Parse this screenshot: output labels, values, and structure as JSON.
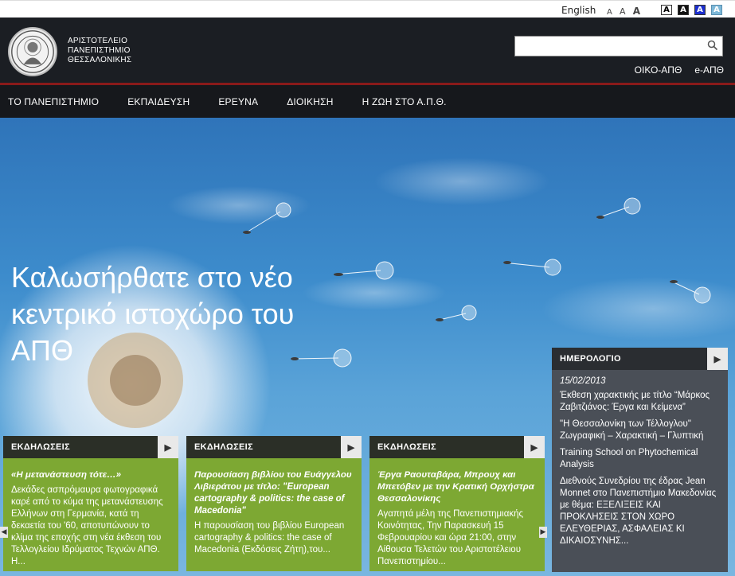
{
  "topbar": {
    "language": "English",
    "font_sizes": [
      "A",
      "A",
      "A"
    ],
    "contrast_options": [
      "A",
      "A",
      "A",
      "A"
    ]
  },
  "header": {
    "university_name": [
      "ΑΡΙΣΤΟΤΕΛΕΙΟ",
      "ΠΑΝΕΠΙΣΤΗΜΙΟ",
      "ΘΕΣΣΑΛΟΝΙΚΗΣ"
    ],
    "search_placeholder": "",
    "links": [
      "ΟΙΚΟ-ΑΠΘ",
      "e-ΑΠΘ"
    ]
  },
  "nav": {
    "items": [
      "ΤΟ ΠΑΝΕΠΙΣΤΗΜΙΟ",
      "ΕΚΠΑΙΔΕΥΣΗ",
      "ΕΡΕΥΝΑ",
      "ΔΙΟΙΚΗΣΗ",
      "Η ΖΩΗ ΣΤΟ Α.Π.Θ."
    ]
  },
  "hero": {
    "welcome": "Καλωσήρθατε στο νέο κεντρικό ιστοχώρο του ΑΠΘ"
  },
  "cards": [
    {
      "heading": "ΕΚΔΗΛΩΣΕΙΣ",
      "title": "«Η μετανάστευση τότε…»",
      "body": "Δεκάδες ασπρόμαυρα φωτογραφικά καρέ από το κύμα της μετανάστευσης Ελλήνων στη Γερμανία, κατά τη δεκαετία του '60, αποτυπώνουν το κλίμα της εποχής στη νέα έκθεση του Τελλογλείου Ιδρύματος Τεχνών ΑΠΘ. Η..."
    },
    {
      "heading": "ΕΚΔΗΛΩΣΕΙΣ",
      "title": "Παρουσίαση βιβλίου του Ευάγγελου Λιβιεράτου με τίτλο: \"European cartography & politics: the case of Macedonia\"",
      "body": "Η παρουσίαση του βιβλίου European cartography & politics: the case of Macedonia (Εκδόσεις Ζήτη),του..."
    },
    {
      "heading": "ΕΚΔΗΛΩΣΕΙΣ",
      "title": "Έργα Ραουταβάρα, Μπρουχ και Μπετόβεν με την Κρατική Ορχήστρα Θεσσαλονίκης",
      "body": "Αγαπητά μέλη της Πανεπιστημιακής Κοινότητας, Την Παρασκευή 15 Φεβρουαρίου και ώρα 21:00, στην Αίθουσα Τελετών του Αριστοτέλειου Πανεπιστημίου..."
    }
  ],
  "calendar": {
    "heading": "ΗΜΕΡΟΛΟΓΙΟ",
    "date": "15/02/2013",
    "items": [
      "Έκθεση χαρακτικής με τίτλο “Μάρκος Ζαβιτζιάνος: Έργα και Κείμενα”",
      "\"Η Θεσσαλονίκη των Τέλλογλου\" Ζωγραφική – Χαρακτική – Γλυπτική",
      "Training School on Phytochemical Analysis",
      "Διεθνούς Συνεδρίου της έδρας Jean Monnet στο Πανεπιστήμιο Μακεδονίας με θέμα: ΕΞΕΛΙΞΕΙΣ ΚΑΙ ΠΡΟΚΛΗΣΕΙΣ ΣΤΟΝ ΧΩΡΟ ΕΛΕΥΘΕΡΙΑΣ, ΑΣΦΑΛΕΙΑΣ ΚΙ ΔΙΚΑΙΟΣΥΝΗΣ..."
    ]
  }
}
